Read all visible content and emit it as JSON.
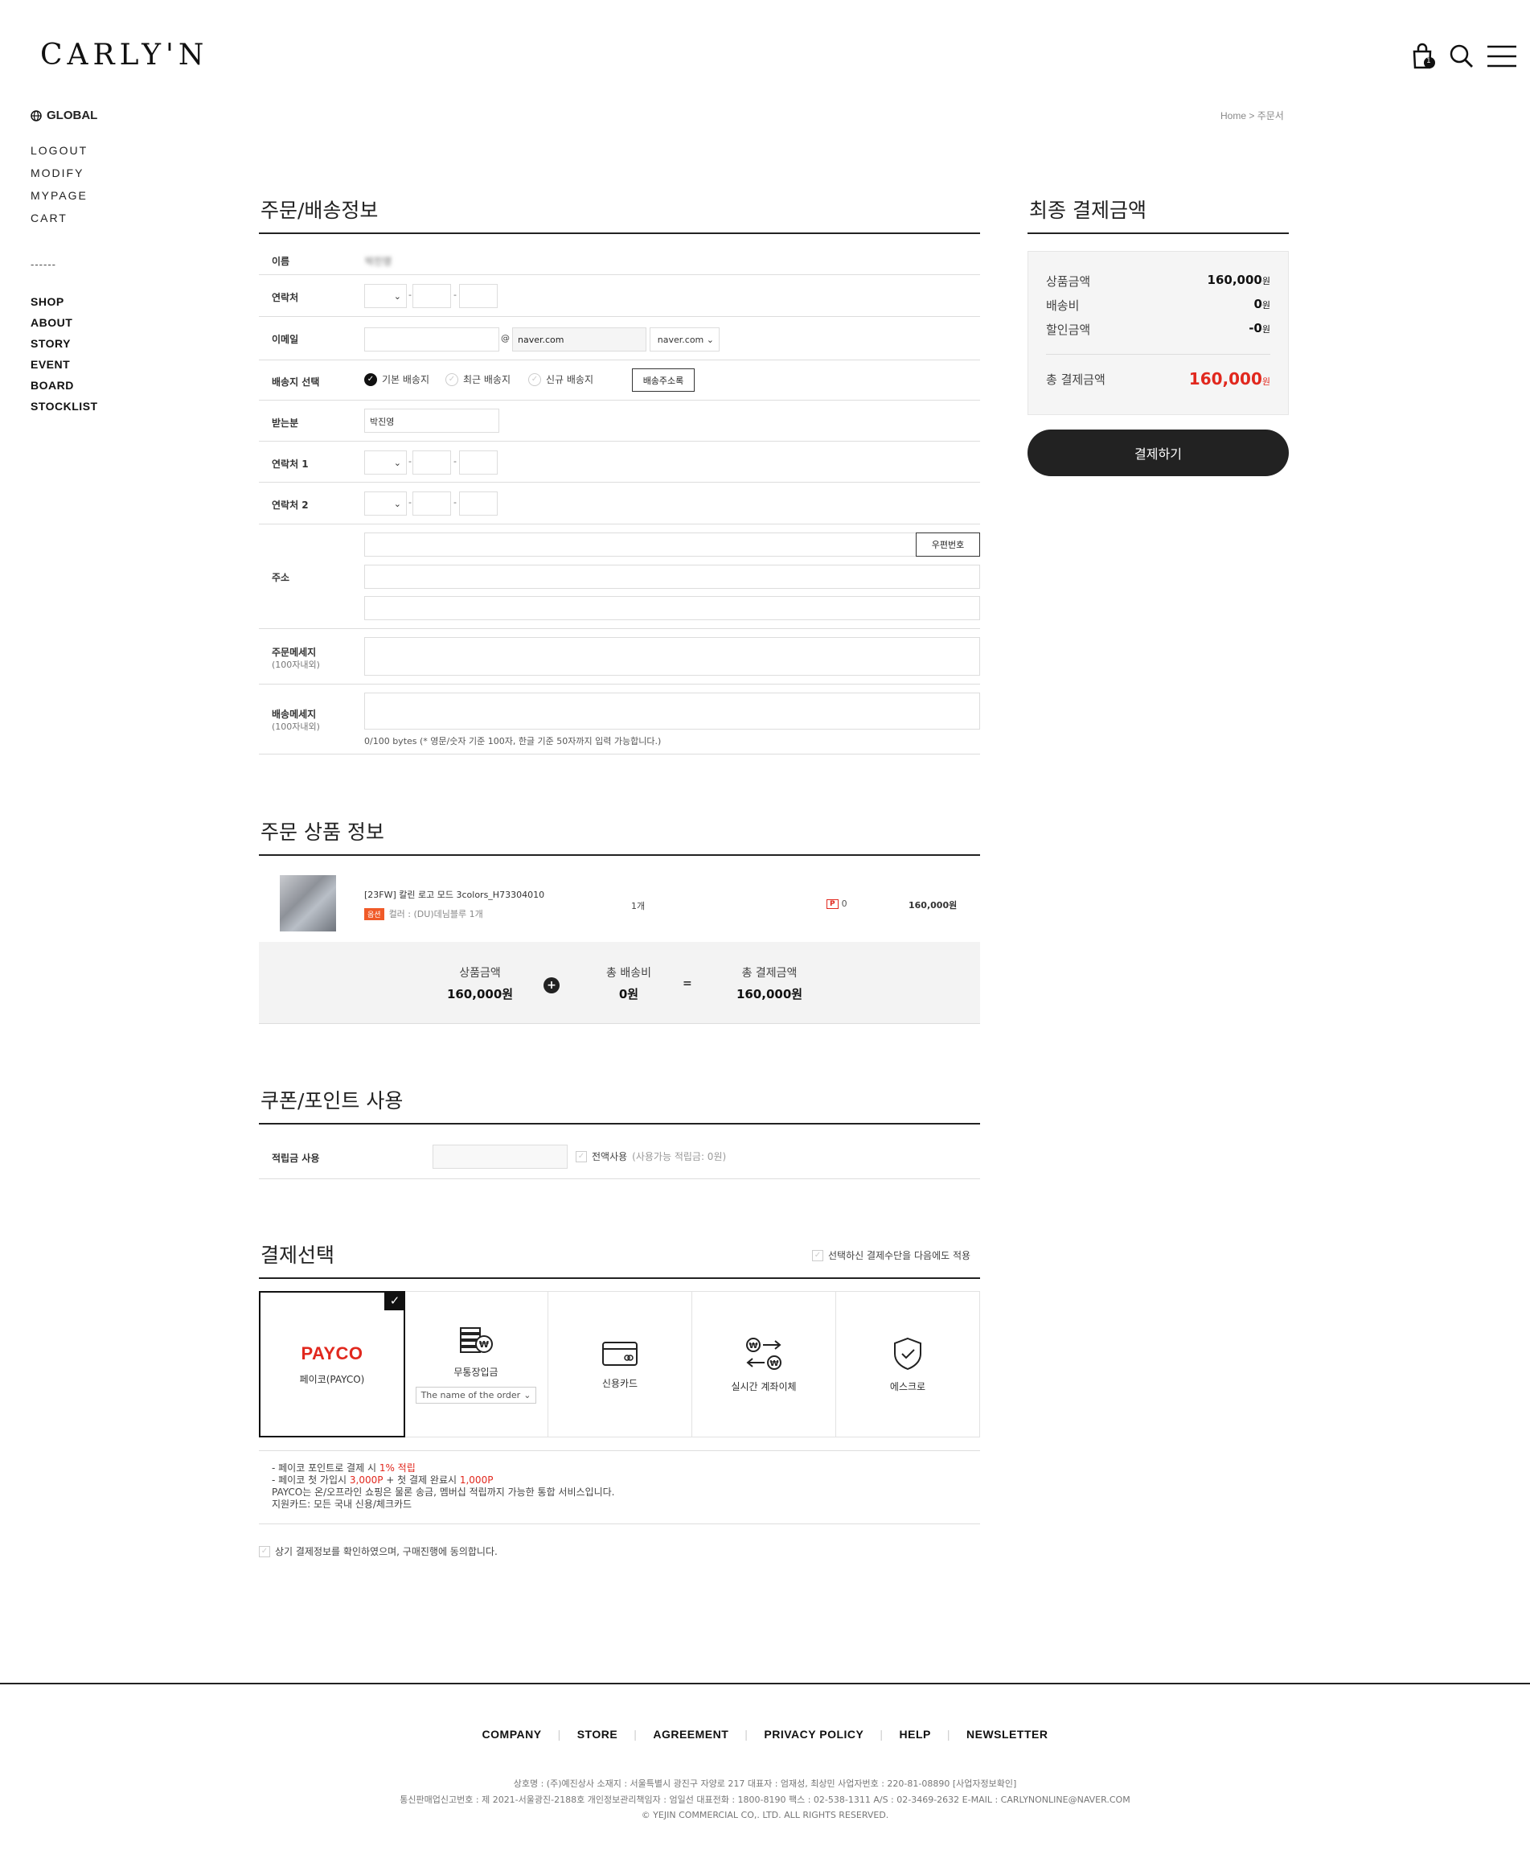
{
  "header": {
    "logo": "CARLY'N",
    "cart_count": "1"
  },
  "nav": {
    "global": "GLOBAL",
    "account": [
      "LOGOUT",
      "MODIFY",
      "MYPAGE",
      "CART"
    ],
    "separator": "------",
    "menu": [
      "SHOP",
      "ABOUT",
      "STORY",
      "EVENT",
      "BOARD",
      "STOCKLIST"
    ]
  },
  "breadcrumb": {
    "home": "Home",
    "sep": " > ",
    "current": "주문서"
  },
  "order_info": {
    "title": "주문/배송정보",
    "name_label": "이름",
    "name_value": "박진영",
    "contact_label": "연락처",
    "email_label": "이메일",
    "email_at": "@",
    "email_domain": "naver.com",
    "email_domain_select": "naver.com",
    "ship_label": "배송지 선택",
    "ship_options": [
      "기본 배송지",
      "최근 배송지",
      "신규 배송지"
    ],
    "ship_list_button": "배송주소록",
    "receiver_label": "받는분",
    "receiver_value": "박진영",
    "contact1_label": "연락처 1",
    "contact2_label": "연락처 2",
    "address_label": "주소",
    "zipcode_button": "우편번호",
    "order_msg_label": "주문메세지",
    "order_msg_sub": "(100자내외)",
    "ship_msg_label": "배송메세지",
    "ship_msg_sub": "(100자내외)",
    "ship_msg_hint": "0/100 bytes (* 영문/숫자 기준 100자, 한글 기준 50자까지 입력 가능합니다.)",
    "dash": "-"
  },
  "summary": {
    "title": "최종 결제금액",
    "product_label": "상품금액",
    "product_value": "160,000",
    "shipping_label": "배송비",
    "shipping_value": "0",
    "discount_label": "할인금액",
    "discount_value": "-0",
    "total_label": "총 결제금액",
    "total_value": "160,000",
    "won": "원",
    "pay_button": "결제하기"
  },
  "product": {
    "title": "주문 상품 정보",
    "name": "[23FW] 칼린 로고 모드 3colors_H73304010",
    "option_badge": "옵션",
    "option_text": "컬러 : (DU)데님블루 1개",
    "qty": "1개",
    "point_badge": "P",
    "point": "0",
    "price": "160,000원",
    "totals": {
      "product_label": "상품금액",
      "product_value": "160,000원",
      "plus": "+",
      "ship_label": "총 배송비",
      "ship_value": "0원",
      "equals": "=",
      "total_label": "총 결제금액",
      "total_value": "160,000원"
    }
  },
  "coupon": {
    "title": "쿠폰/포인트 사용",
    "points_label": "적립금 사용",
    "use_all": "전액사용",
    "available": "(사용가능 적립금: 0원)"
  },
  "payment": {
    "title": "결제선택",
    "remember": "선택하신 결제수단을 다음에도 적용",
    "methods": [
      {
        "logo": "PAYCO",
        "label": "페이코(PAYCO)"
      },
      {
        "label": "무통장입금",
        "select": "The name of the order"
      },
      {
        "label": "신용카드"
      },
      {
        "label": "실시간 계좌이체"
      },
      {
        "label": "에스크로"
      }
    ],
    "notes": {
      "l1_prefix": "- 페이코 포인트로 결제 시 ",
      "l1_red": "1% 적립",
      "l2_prefix": "- 페이코 첫 가입시 ",
      "l2_red1": "3,000P",
      "l2_mid": " + 첫 결제 완료시 ",
      "l2_red2": "1,000P",
      "l3": "PAYCO는 온/오프라인 쇼핑은 물론 송금, 멤버십 적립까지 가능한 통합 서비스입니다.",
      "l4": "지원카드: 모든 국내 신용/체크카드"
    },
    "agree": "상기 결제정보를 확인하였으며, 구매진행에 동의합니다."
  },
  "footer": {
    "links": [
      "COMPANY",
      "STORE",
      "AGREEMENT",
      "PRIVACY POLICY",
      "HELP",
      "NEWSLETTER"
    ],
    "bar": "|",
    "info1": "상호명 : (주)예진상사 소재지 : 서울특별시 광진구 자양로 217 대표자 : 엄재성, 최상민 사업자번호 : 220-81-08890 [사업자정보확인]",
    "info2": "통신판매업신고번호 : 제 2021-서울광진-2188호 개인정보관리책임자 : 엄일선 대표전화 : 1800-8190 팩스 : 02-538-1311 A/S : 02-3469-2632 E-MAIL : CARLYNONLINE@NAVER.COM",
    "copyright": "© YEJIN COMMERCIAL CO,. LTD. ALL RIGHTS RESERVED."
  }
}
